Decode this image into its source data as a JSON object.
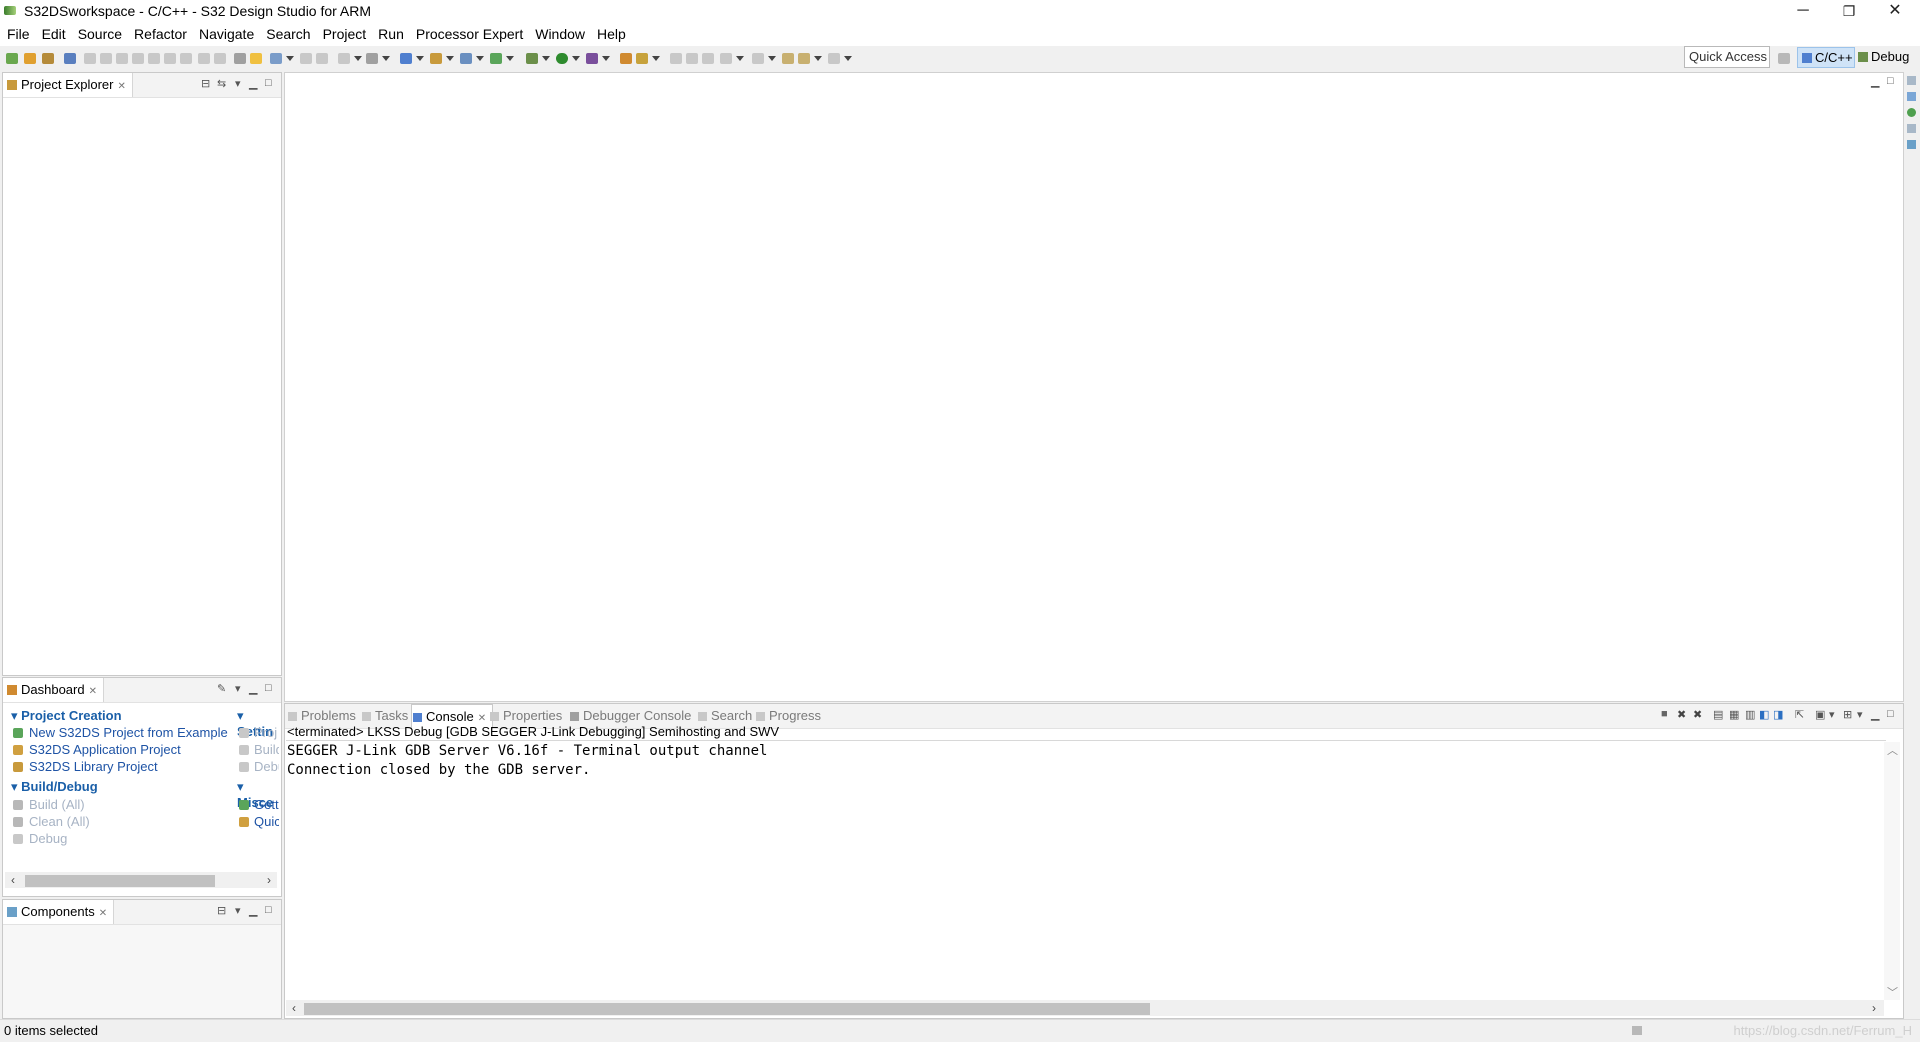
{
  "window": {
    "title": "S32DSworkspace - C/C++ - S32 Design Studio for ARM",
    "minimize": "─",
    "restore": "❐",
    "close": "✕"
  },
  "menu": [
    "File",
    "Edit",
    "Source",
    "Refactor",
    "Navigate",
    "Search",
    "Project",
    "Run",
    "Processor Expert",
    "Window",
    "Help"
  ],
  "toolbar": {
    "quick_access": "Quick Access",
    "perspective_cpp": "C/C++",
    "perspective_debug": "Debug"
  },
  "project_explorer": {
    "tab": "Project Explorer"
  },
  "dashboard": {
    "tab": "Dashboard",
    "sections": {
      "project_creation": "Project Creation",
      "settings": "Settin",
      "build_debug": "Build/Debug",
      "misc": "Misce"
    },
    "links": {
      "new_from_example": "New S32DS Project from Example",
      "app_project": "S32DS Application Project",
      "lib_project": "S32DS Library Project",
      "build_all": "Build  (All)",
      "clean_all": "Clean  (All)",
      "debug": "Debug",
      "settings_1": "Proj",
      "settings_2": "Build",
      "settings_3": "Debu",
      "misc_1": "Getti",
      "misc_2": "Quic"
    }
  },
  "components": {
    "tab": "Components"
  },
  "bottom_tabs": {
    "problems": "Problems",
    "tasks": "Tasks",
    "console": "Console",
    "properties": "Properties",
    "debugger_console": "Debugger Console",
    "search": "Search",
    "progress": "Progress"
  },
  "console": {
    "header": "<terminated> LKSS Debug [GDB SEGGER J-Link Debugging] Semihosting and SWV",
    "lines": [
      "SEGGER J-Link GDB Server V6.16f - Terminal output channel",
      "Connection closed by the GDB server."
    ]
  },
  "status": {
    "text": "0 items selected",
    "watermark": "https://blog.csdn.net/Ferrum_H"
  },
  "colors": {
    "accent": "#1e53a5",
    "selected_perspective": "#cfe3f7"
  }
}
